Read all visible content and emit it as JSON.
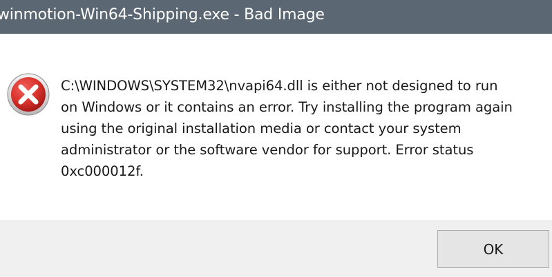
{
  "window": {
    "title": "winmotion-Win64-Shipping.exe - Bad Image"
  },
  "dialog": {
    "icon": "error-icon",
    "message_lines": [
      "C:\\WINDOWS\\SYSTEM32\\nvapi64.dll is either not designed to run",
      "on Windows or it contains an error. Try installing the program again",
      "using the original installation media or contact your system",
      "administrator or the software vendor for support. Error status",
      "0xc000012f."
    ]
  },
  "buttons": {
    "ok_label": "OK"
  },
  "colors": {
    "titlebar": "#5b6772",
    "footer": "#f0f0f0",
    "error_red": "#d9322c"
  }
}
